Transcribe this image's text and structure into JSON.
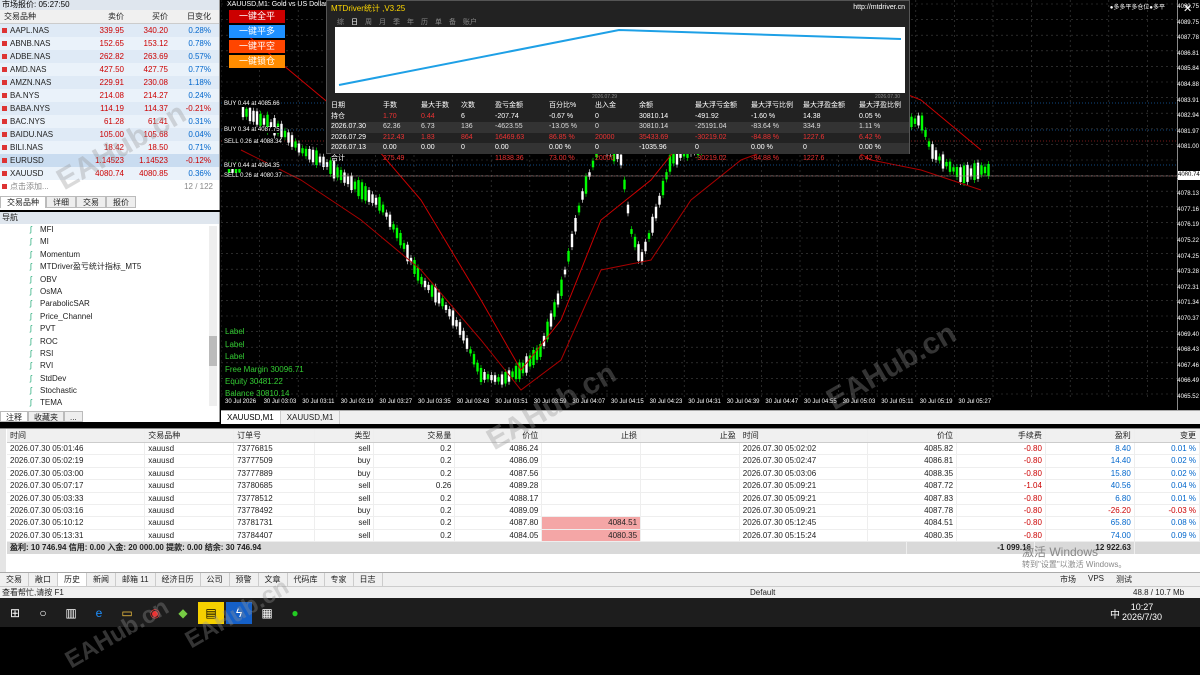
{
  "market_watch": {
    "title": "市场报价: 05:27:50",
    "headers": [
      "交易品种",
      "卖价",
      "买价",
      "日变化"
    ],
    "rows": [
      {
        "sym": "AAPL.NAS",
        "bid": "339.95",
        "ask": "340.20",
        "chg": "0.28%",
        "neg": false
      },
      {
        "sym": "ABNB.NAS",
        "bid": "152.65",
        "ask": "153.12",
        "chg": "0.78%",
        "neg": false
      },
      {
        "sym": "ADBE.NAS",
        "bid": "262.82",
        "ask": "263.69",
        "chg": "0.57%",
        "neg": false
      },
      {
        "sym": "AMD.NAS",
        "bid": "427.50",
        "ask": "427.75",
        "chg": "0.77%",
        "neg": false
      },
      {
        "sym": "AMZN.NAS",
        "bid": "229.91",
        "ask": "230.08",
        "chg": "1.18%",
        "neg": false
      },
      {
        "sym": "BA.NYS",
        "bid": "214.08",
        "ask": "214.27",
        "chg": "0.24%",
        "neg": false
      },
      {
        "sym": "BABA.NYS",
        "bid": "114.19",
        "ask": "114.37",
        "chg": "-0.21%",
        "neg": true
      },
      {
        "sym": "BAC.NYS",
        "bid": "61.28",
        "ask": "61.41",
        "chg": "0.31%",
        "neg": false
      },
      {
        "sym": "BAIDU.NAS",
        "bid": "105.00",
        "ask": "105.68",
        "chg": "0.04%",
        "neg": false
      },
      {
        "sym": "BILI.NAS",
        "bid": "18.42",
        "ask": "18.50",
        "chg": "0.71%",
        "neg": false
      },
      {
        "sym": "EURUSD",
        "bid": "1.14523",
        "ask": "1.14523",
        "chg": "-0.12%",
        "neg": true
      },
      {
        "sym": "XAUUSD",
        "bid": "4080.74",
        "ask": "4080.85",
        "chg": "0.36%",
        "neg": false
      }
    ],
    "add_label": "点击添加...",
    "count": "12 / 122",
    "tabs": [
      "交易品种",
      "详细",
      "交易",
      "报价"
    ]
  },
  "navigator": {
    "title": "导航",
    "items": [
      "MFI",
      "MI",
      "Momentum",
      "MTDriver盈亏统计指标_MT5",
      "OBV",
      "OsMA",
      "ParabolicSAR",
      "Price_Channel",
      "PVT",
      "ROC",
      "RSI",
      "RVI",
      "StdDev",
      "Stochastic",
      "TEMA"
    ],
    "tabs": [
      "注释",
      "收藏夹",
      "..."
    ]
  },
  "chart": {
    "title": "XAUUSD,M1: Gold vs US Dollar",
    "buttons": [
      "一键全平",
      "一键平多",
      "一键平空",
      "一键锁仓"
    ],
    "order_tags": [
      "BUY 0.44 at 4085.66",
      "BUY 0.34 at 4087.75",
      "SELL 0.26 at 4088.34",
      "BUY 0.44 at 4084.35",
      "SELL 0.26 at 4080.37"
    ],
    "labels": [
      "Label",
      "Label",
      "Label",
      "Free Margin 30096.71",
      "Equity 30481.22",
      "Balance 30810.14"
    ],
    "price_labels": [
      "4090.75",
      "4089.75",
      "4087.78",
      "4086.81",
      "4085.84",
      "4084.88",
      "4083.91",
      "4082.94",
      "4081.97",
      "4081.00",
      "4080.74",
      "4079.10",
      "4078.13",
      "4077.16",
      "4076.19",
      "4075.22",
      "4074.25",
      "4073.28",
      "4072.31",
      "4071.34",
      "4070.37",
      "4069.40",
      "4068.43",
      "4067.46",
      "4066.49",
      "4065.52"
    ],
    "time_labels": [
      "30 Jul 2026",
      "30 Jul 03:03",
      "30 Jul 03:11",
      "30 Jul 03:19",
      "30 Jul 03:27",
      "30 Jul 03:35",
      "30 Jul 03:43",
      "30 Jul 03:51",
      "30 Jul 03:59",
      "30 Jul 04:07",
      "30 Jul 04:15",
      "30 Jul 04:23",
      "30 Jul 04:31",
      "30 Jul 04:39",
      "30 Jul 04:47",
      "30 Jul 04:55",
      "30 Jul 05:03",
      "30 Jul 05:11",
      "30 Jul 05:19",
      "30 Jul 05:27"
    ],
    "corner_text": "●多多平多仓位●多平",
    "bid_label": "4080.74"
  },
  "mtdriver": {
    "title": "MTDriver统计 ,V3.25",
    "url": "http://mtdriver.cn",
    "tabs": [
      "综",
      "日",
      "周",
      "月",
      "季",
      "年",
      "历",
      "单",
      "备",
      "账户"
    ],
    "graph_dates": [
      "2026.07.29",
      "2026.07.30"
    ],
    "headers": [
      "日期",
      "手数",
      "最大手数",
      "次数",
      "盈亏金额",
      "百分比%",
      "出入金",
      "余额",
      "最大浮亏金额",
      "最大浮亏比例",
      "最大浮盈金额",
      "最大浮盈比例"
    ],
    "rows": [
      [
        "持仓",
        "1.70",
        "0.44",
        "6",
        "-207.74",
        "-0.67 %",
        "0",
        "30810.14",
        "-491.92",
        "-1.60 %",
        "14.38",
        "0.05 %"
      ],
      [
        "2026.07.30",
        "62.36",
        "6.73",
        "136",
        "-4623.55",
        "-13.05 %",
        "0",
        "30810.14",
        "-25191.04",
        "-83.64 %",
        "334.9",
        "1.11 %"
      ],
      [
        "2026.07.29",
        "212.43",
        "1.83",
        "864",
        "16469.63",
        "86.85 %",
        "20000",
        "35433.69",
        "-30219.02",
        "-84.88 %",
        "1227.6",
        "6.42 %"
      ],
      [
        "2026.07.13",
        "0.00",
        "0.00",
        "0",
        "0.00",
        "0.00 %",
        "0",
        "-1035.96",
        "0",
        "0.00 %",
        "0",
        "0.00 %"
      ],
      [
        "合计",
        "275.49",
        "",
        "",
        "11838.36",
        "73.00 %",
        "20000",
        "",
        "-30219.02",
        "-84.88 %",
        "1227.6",
        "6.42 %"
      ]
    ]
  },
  "chart_tabs": [
    "XAUUSD,M1",
    "XAUUSD,M1"
  ],
  "toolbox": {
    "headers": [
      "时间",
      "交易品种",
      "订单号",
      "类型",
      "交易量",
      "价位",
      "止损",
      "止盈",
      "时间",
      "价位",
      "手续费",
      "盈利",
      "变更"
    ],
    "rows": [
      [
        "2026.07.30 05:01:46",
        "xauusd",
        "73776815",
        "sell",
        "0.2",
        "4086.24",
        "",
        "",
        "2026.07.30 05:02:02",
        "4085.82",
        "-0.80",
        "8.40",
        "0.01 %"
      ],
      [
        "2026.07.30 05:02:19",
        "xauusd",
        "73777509",
        "buy",
        "0.2",
        "4086.09",
        "",
        "",
        "2026.07.30 05:02:47",
        "4086.81",
        "-0.80",
        "14.40",
        "0.02 %"
      ],
      [
        "2026.07.30 05:03:00",
        "xauusd",
        "73777889",
        "buy",
        "0.2",
        "4087.56",
        "",
        "",
        "2026.07.30 05:03:06",
        "4088.35",
        "-0.80",
        "15.80",
        "0.02 %"
      ],
      [
        "2026.07.30 05:07:17",
        "xauusd",
        "73780685",
        "sell",
        "0.26",
        "4089.28",
        "",
        "",
        "2026.07.30 05:09:21",
        "4087.72",
        "-1.04",
        "40.56",
        "0.04 %"
      ],
      [
        "2026.07.30 05:03:33",
        "xauusd",
        "73778512",
        "sell",
        "0.2",
        "4088.17",
        "",
        "",
        "2026.07.30 05:09:21",
        "4087.83",
        "-0.80",
        "6.80",
        "0.01 %"
      ],
      [
        "2026.07.30 05:03:16",
        "xauusd",
        "73778492",
        "buy",
        "0.2",
        "4089.09",
        "",
        "",
        "2026.07.30 05:09:21",
        "4087.78",
        "-0.80",
        "-26.20",
        "-0.03 %"
      ],
      [
        "2026.07.30 05:10:12",
        "xauusd",
        "73781731",
        "sell",
        "0.2",
        "4087.80",
        "4084.51",
        "",
        "2026.07.30 05:12:45",
        "4084.51",
        "-0.80",
        "65.80",
        "0.08 %"
      ],
      [
        "2026.07.30 05:13:31",
        "xauusd",
        "73784407",
        "sell",
        "0.2",
        "4084.05",
        "4080.35",
        "",
        "2026.07.30 05:15:24",
        "4080.35",
        "-0.80",
        "74.00",
        "0.09 %"
      ]
    ],
    "totals": "盈利: 10 746.94  信用: 0.00  入金: 20 000.00  提款: 0.00  结余: 30 746.94",
    "total_fee": "-1 099.16",
    "total_profit": "12 922.63"
  },
  "bottom_tabs": [
    "交易",
    "敞口",
    "历史",
    "新闻",
    "邮箱 11",
    "经济日历",
    "公司",
    "预警",
    "文章",
    "代码库",
    "专家",
    "日志"
  ],
  "status": {
    "left": "查看帮忙,请按 F1",
    "mid": "Default",
    "right": "48.8 / 10.7 Mb",
    "activate": "激活 Windows",
    "activate_sub": "转到\"设置\"以激活 Windows。"
  },
  "tray": {
    "market": "市场",
    "vps": "VPS",
    "test": "测试",
    "time": "10:27",
    "date": "2026/7/30",
    "ime": "中"
  },
  "watermark": "EAHub.cn"
}
